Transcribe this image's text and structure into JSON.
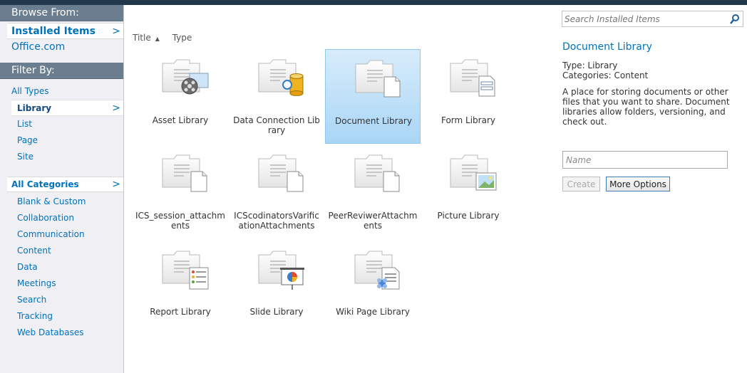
{
  "browse": {
    "header": "Browse From:",
    "items": [
      {
        "label": "Installed Items",
        "selected": true
      },
      {
        "label": "Office.com",
        "selected": false
      }
    ]
  },
  "filter": {
    "header": "Filter By:",
    "types": [
      "All Types",
      "Library",
      "List",
      "Page",
      "Site"
    ],
    "selected_type": "Library"
  },
  "categories": {
    "header": "All Categories",
    "items": [
      "Blank & Custom",
      "Collaboration",
      "Communication",
      "Content",
      "Data",
      "Meetings",
      "Search",
      "Tracking",
      "Web Databases"
    ]
  },
  "sort": {
    "title_label": "Title",
    "type_label": "Type",
    "title_arrow": "▲"
  },
  "tiles": [
    {
      "label": "Asset Library",
      "icon": "asset-library-icon"
    },
    {
      "label": "Data Connection Library",
      "icon": "data-connection-icon"
    },
    {
      "label": "Document Library",
      "icon": "document-library-icon",
      "selected": true
    },
    {
      "label": "Form Library",
      "icon": "form-library-icon"
    },
    {
      "label": "ICS_session_attachments",
      "icon": "document-icon"
    },
    {
      "label": "ICScodinatorsVarificationAttachments",
      "icon": "document-icon"
    },
    {
      "label": "PeerReviwerAttachments",
      "icon": "document-icon"
    },
    {
      "label": "Picture Library",
      "icon": "picture-library-icon"
    },
    {
      "label": "Report Library",
      "icon": "report-library-icon"
    },
    {
      "label": "Slide Library",
      "icon": "slide-library-icon"
    },
    {
      "label": "Wiki Page Library",
      "icon": "wiki-library-icon"
    }
  ],
  "search": {
    "placeholder": "Search Installed Items"
  },
  "details": {
    "title": "Document Library",
    "type_line": "Type: Library",
    "categories_line": "Categories: Content",
    "description": "A place for storing documents or other files that you want to share. Document libraries allow folders, versioning, and check out."
  },
  "form": {
    "name_placeholder": "Name",
    "create_label": "Create",
    "more_options_label": "More Options"
  },
  "colors": {
    "accent": "#0072bc",
    "nav_header": "#6b7e8f",
    "selected_tile": "#a9d6f6",
    "topbar": "#21374c"
  }
}
